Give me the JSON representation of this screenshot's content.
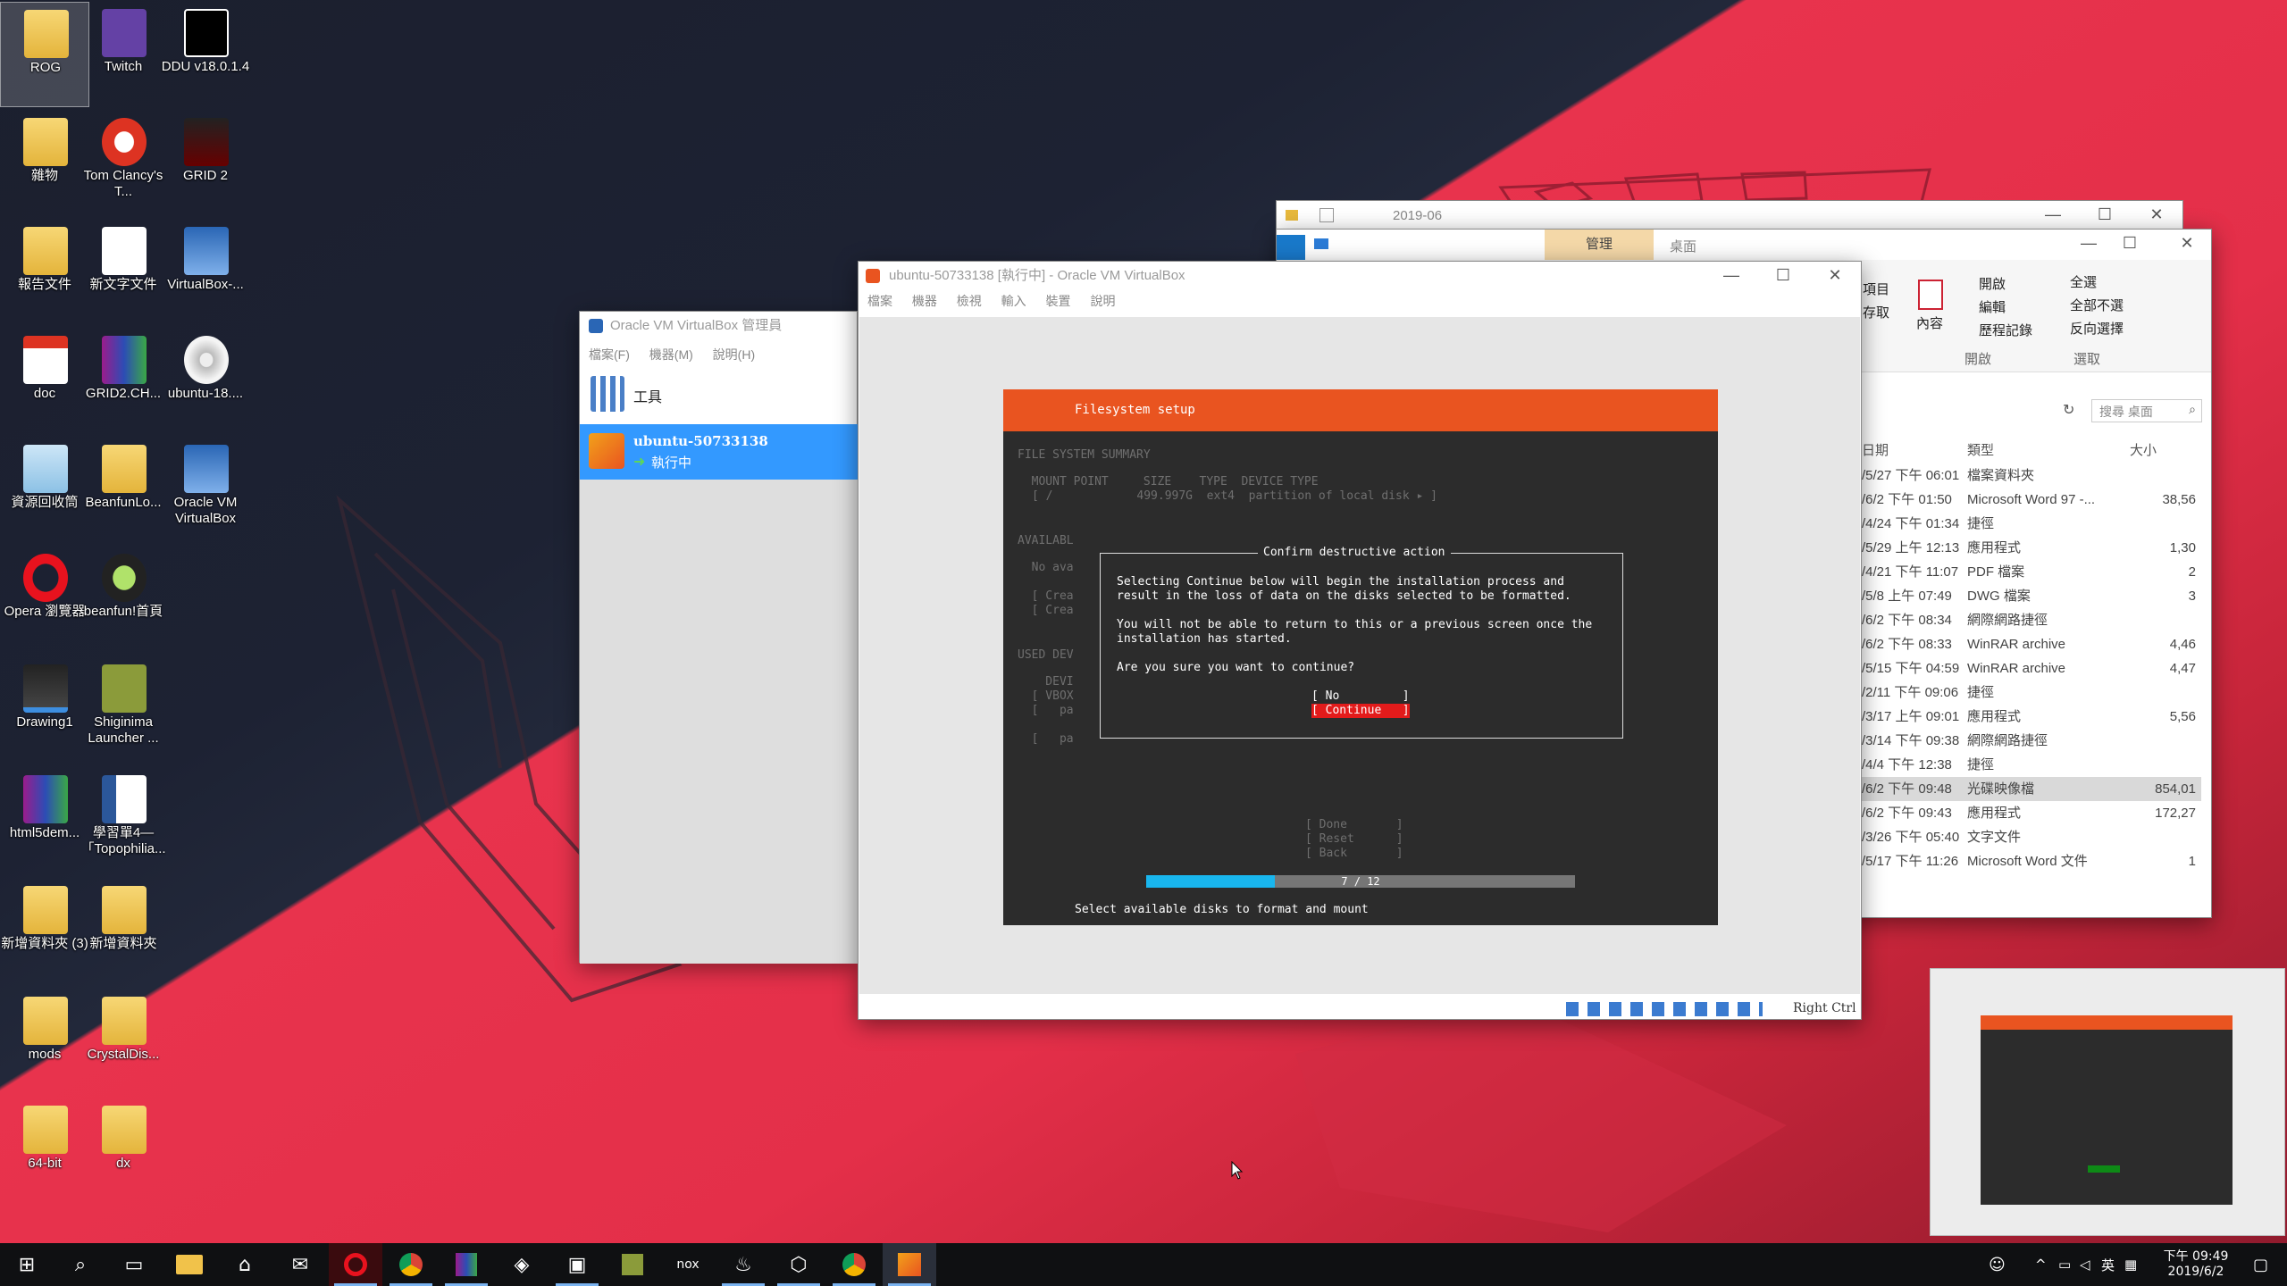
{
  "desktop": {
    "icons": [
      {
        "label": "ROG",
        "icon": "rog-folder-icon"
      },
      {
        "label": "Twitch",
        "icon": "twitch-icon"
      },
      {
        "label": "DDU v18.0.1.4",
        "icon": "7zip-icon"
      },
      {
        "label": "雜物",
        "icon": "folder-icon"
      },
      {
        "label": "Tom Clancy's T...",
        "icon": "game-icon"
      },
      {
        "label": "GRID 2",
        "icon": "grid2-icon"
      },
      {
        "label": "報告文件",
        "icon": "folder-icon"
      },
      {
        "label": "新文字文件",
        "icon": "text-file-icon"
      },
      {
        "label": "VirtualBox-...",
        "icon": "virtualbox-icon"
      },
      {
        "label": "doc",
        "icon": "pdf-icon"
      },
      {
        "label": "GRID2.CH...",
        "icon": "winrar-icon"
      },
      {
        "label": "ubuntu-18....",
        "icon": "disc-image-icon"
      },
      {
        "label": "資源回收筒",
        "icon": "recycle-bin-icon"
      },
      {
        "label": "BeanfunLo...",
        "icon": "folder-icon"
      },
      {
        "label": "Oracle VM VirtualBox",
        "icon": "virtualbox-icon"
      },
      {
        "label": "Opera 瀏覽器",
        "icon": "opera-icon"
      },
      {
        "label": "beanfun!首頁",
        "icon": "beanfun-icon"
      },
      {
        "label": "Drawing1",
        "icon": "drawing-icon"
      },
      {
        "label": "Shiginima Launcher ...",
        "icon": "minecraft-icon"
      },
      {
        "label": "html5dem...",
        "icon": "winrar-icon"
      },
      {
        "label": "學習單4—「Topophilia...",
        "icon": "word-icon"
      },
      {
        "label": "新增資料夾 (3)",
        "icon": "folder-icon"
      },
      {
        "label": "新增資料夾",
        "icon": "folder-icon"
      },
      {
        "label": "mods",
        "icon": "folder-icon"
      },
      {
        "label": "CrystalDis...",
        "icon": "folder-icon"
      },
      {
        "label": "64-bit",
        "icon": "folder-icon"
      },
      {
        "label": "dx",
        "icon": "folder-icon"
      }
    ]
  },
  "vbox_manager": {
    "title": "Oracle VM VirtualBox 管理員",
    "menu": [
      "檔案(F)",
      "機器(M)",
      "說明(H)"
    ],
    "tools_label": "工具",
    "vm_name": "ubuntu-50733138",
    "vm_state": "執行中"
  },
  "vm_window": {
    "title": "ubuntu-50733138 [執行中] - Oracle VM VirtualBox",
    "menu": [
      "檔案",
      "機器",
      "檢視",
      "輸入",
      "裝置",
      "說明"
    ],
    "hostkey": "Right Ctrl",
    "screen": {
      "header": "Filesystem setup",
      "summary_title": "FILE SYSTEM SUMMARY",
      "summary_cols": "  MOUNT POINT     SIZE    TYPE  DEVICE TYPE",
      "summary_row": "[ /            499.997G  ext4  partition of local disk ▸ ]",
      "avail_title": "AVAILABL",
      "no_avail": "  No ava",
      "create1": "  [ Crea",
      "create2": "  [ Crea",
      "used_title": "USED DEV",
      "used_devi": "    DEVI",
      "used_vbox": "  [ VBOX",
      "used_pa1": "  [   pa",
      "used_pa2": "  [   pa",
      "done": "[ Done       ]",
      "reset": "[ Reset      ]",
      "back": "[ Back       ]",
      "progress_text": "7 / 12",
      "progress_fraction": 0.3,
      "footer": "Select available disks to format and mount",
      "dialog": {
        "title": "Confirm destructive action",
        "line1": "Selecting Continue below will begin the installation process and",
        "line2": "result in the loss of data on the disks selected to be formatted.",
        "line3": "You will not be able to return to this or a previous screen once the",
        "line4": "installation has started.",
        "question": "Are you sure you want to continue?",
        "no": "[ No         ]",
        "continue": "[ Continue   ]"
      }
    }
  },
  "explorer_back": {
    "title": "2019-06"
  },
  "explorer": {
    "tab_manage": "管理",
    "tab_desktop": "桌面",
    "ribbon": {
      "open_menu": "開啟",
      "edit": "編輯",
      "history": "歷程記錄",
      "properties": "內容",
      "open_group": "開啟",
      "select_all": "全選",
      "select_none": "全部不選",
      "invert": "反向選擇",
      "select_group": "選取",
      "left1": "項目",
      "left2": "存取"
    },
    "search_placeholder": "搜尋 桌面",
    "columns": {
      "date": "日期",
      "type": "類型",
      "size": "大小"
    },
    "rows": [
      {
        "date": "/5/27 下午 06:01",
        "type": "檔案資料夾",
        "size": ""
      },
      {
        "date": "/6/2 下午 01:50",
        "type": "Microsoft Word 97 -...",
        "size": "38,56"
      },
      {
        "date": "/4/24 下午 01:34",
        "type": "捷徑",
        "size": ""
      },
      {
        "date": "/5/29 上午 12:13",
        "type": "應用程式",
        "size": "1,30"
      },
      {
        "date": "/4/21 下午 11:07",
        "type": "PDF 檔案",
        "size": "2"
      },
      {
        "date": "/5/8 上午 07:49",
        "type": "DWG 檔案",
        "size": "3"
      },
      {
        "date": "/6/2 下午 08:34",
        "type": "網際網路捷徑",
        "size": ""
      },
      {
        "date": "/6/2 下午 08:33",
        "type": "WinRAR archive",
        "size": "4,46"
      },
      {
        "date": "/5/15 下午 04:59",
        "type": "WinRAR archive",
        "size": "4,47"
      },
      {
        "date": "/2/11 下午 09:06",
        "type": "捷徑",
        "size": ""
      },
      {
        "date": "/3/17 上午 09:01",
        "type": "應用程式",
        "size": "5,56"
      },
      {
        "date": "/3/14 下午 09:38",
        "type": "網際網路捷徑",
        "size": ""
      },
      {
        "date": "/4/4 下午 12:38",
        "type": "捷徑",
        "size": ""
      },
      {
        "date": "/6/2 下午 09:48",
        "type": "光碟映像檔",
        "size": "854,01"
      },
      {
        "date": "/6/2 下午 09:43",
        "type": "應用程式",
        "size": "172,27"
      },
      {
        "date": "/3/26 下午 05:40",
        "type": "文字文件",
        "size": ""
      },
      {
        "date": "/5/17 下午 11:26",
        "type": "Microsoft Word 文件",
        "size": "1"
      }
    ]
  },
  "taskbar": {
    "time": "下午 09:49",
    "date": "2019/6/2",
    "ime": "英"
  },
  "colors": {
    "ubuntu_orange": "#e95420",
    "selection_blue": "#3399ff",
    "continue_red": "#e31b1b"
  }
}
